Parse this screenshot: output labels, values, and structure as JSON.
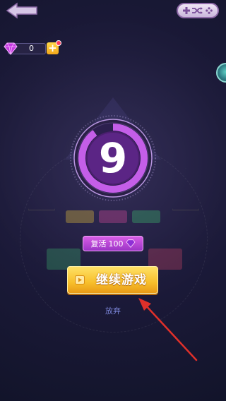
{
  "header": {
    "back_icon": "back-arrow-icon",
    "shuffle_icon": "shuffle-icon"
  },
  "currency": {
    "gem_count": "0",
    "gem_icon": "gem-icon",
    "add_label": "+"
  },
  "countdown": {
    "value": "9",
    "remaining_fraction": 0.9
  },
  "revive": {
    "label": "复活",
    "cost": "100",
    "gem_icon": "gem-icon"
  },
  "continue_button": {
    "label": "继续游戏",
    "icon": "video-icon"
  },
  "give_up": {
    "label": "放弃"
  },
  "colors": {
    "background": "#1c1a3a",
    "countdown_ring": "#c45ee8",
    "revive_button": "#c04ddb",
    "continue_button": "#f7bf2b",
    "give_up_text": "#7a84d6",
    "annotation_arrow": "#e0302a"
  }
}
